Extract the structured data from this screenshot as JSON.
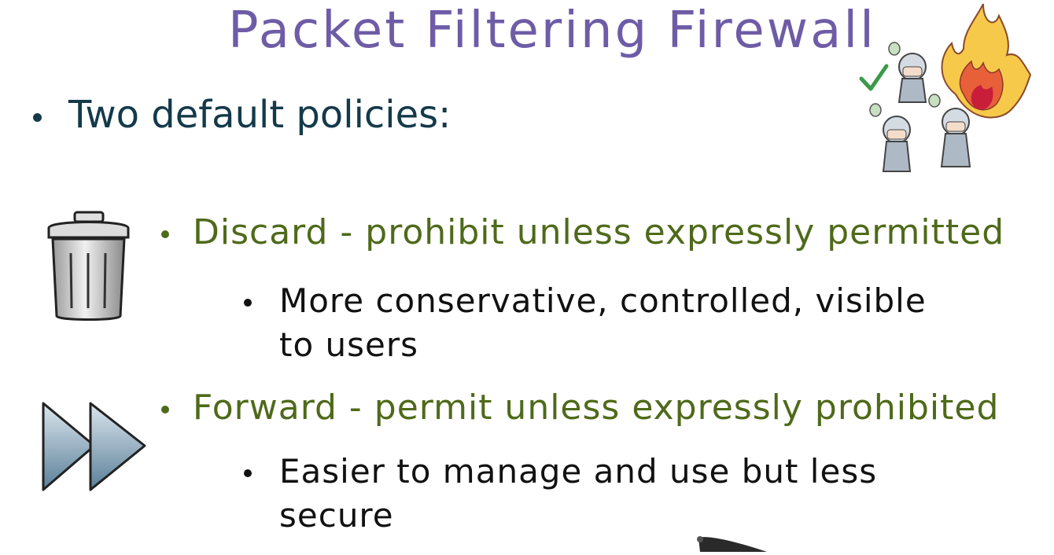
{
  "slide": {
    "title": "Packet Filtering Firewall",
    "intro": "Two default policies:",
    "policies": [
      {
        "heading": "Discard - prohibit unless expressly permitted",
        "detail": "More conservative, controlled, visible to users",
        "icon": "trash-can-icon"
      },
      {
        "heading": "Forward - permit unless expressly prohibited",
        "detail": "Easier to manage and use but less secure",
        "icon": "fast-forward-icon"
      }
    ]
  },
  "colors": {
    "title": "#6e5ca6",
    "intro": "#143a4a",
    "policy": "#4e6a1a",
    "detail": "#111111"
  },
  "illustrations": [
    "knights-with-checkmark-illustration",
    "fire-illustration",
    "pen-tip-illustration"
  ]
}
